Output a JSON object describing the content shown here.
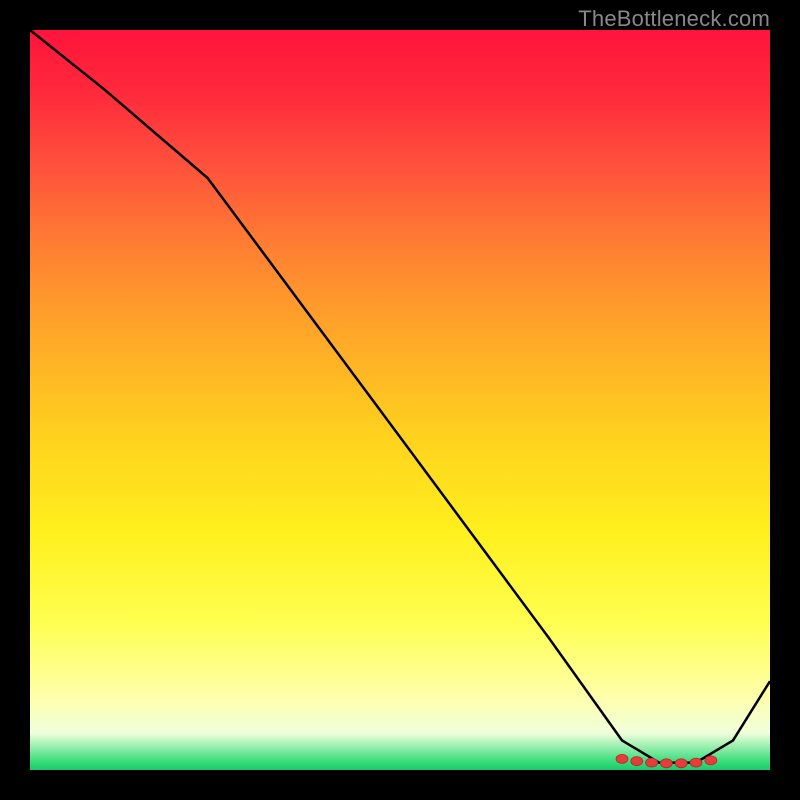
{
  "watermark": "TheBottleneck.com",
  "chart_data": {
    "type": "line",
    "title": "",
    "xlabel": "",
    "ylabel": "",
    "xlim": [
      0,
      100
    ],
    "ylim": [
      0,
      100
    ],
    "grid": false,
    "series": [
      {
        "name": "curve",
        "x": [
          0,
          10,
          24,
          50,
          70,
          80,
          85,
          90,
          95,
          100
        ],
        "values": [
          100,
          92,
          80,
          45,
          18,
          4,
          1,
          1,
          4,
          12
        ]
      }
    ],
    "markers": {
      "name": "highlight",
      "x": [
        80,
        82,
        84,
        86,
        88,
        90,
        92
      ],
      "values": [
        1.5,
        1.2,
        1.0,
        0.9,
        0.9,
        1.0,
        1.3
      ]
    },
    "background_gradient": {
      "top": "#ff143c",
      "mid": "#ffff50",
      "bottom": "#1ec86e"
    }
  }
}
